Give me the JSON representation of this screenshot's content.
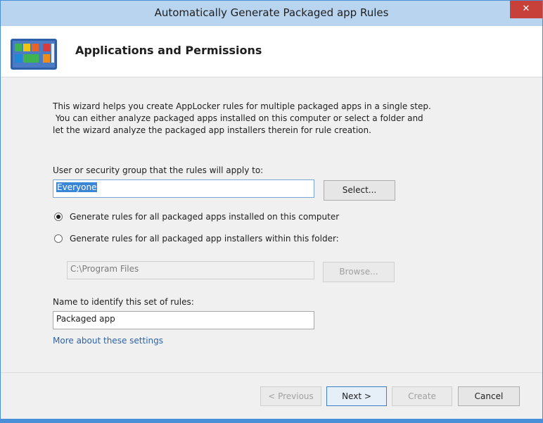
{
  "window": {
    "title": "Automatically Generate Packaged app Rules",
    "close_glyph": "✕"
  },
  "header": {
    "heading": "Applications and Permissions",
    "icon": "applocker-packaged-apps-icon"
  },
  "description": {
    "line1": "This wizard helps you create AppLocker rules for multiple packaged apps in a single step.",
    "line2": " You can either analyze packaged apps installed on this computer or select a folder and",
    "line3": "let the wizard analyze the packaged app installers therein for rule creation."
  },
  "user_group": {
    "label": "User or security group that the rules will apply to:",
    "value": "Everyone",
    "select_button": "Select..."
  },
  "options": {
    "installed_label": "Generate rules for all packaged apps installed on this computer",
    "installed_checked": true,
    "folder_label": "Generate rules for all packaged app installers within this folder:",
    "folder_checked": false,
    "folder_path": "C:\\Program Files",
    "browse_button": "Browse..."
  },
  "rule_name": {
    "label": "Name to identify this set of rules:",
    "value": "Packaged app"
  },
  "more_link": "More about these settings",
  "footer": {
    "previous": "< Previous",
    "next": "Next >",
    "create": "Create",
    "cancel": "Cancel"
  },
  "colors": {
    "accent": "#4a90d9",
    "titlebar": "#b8d4ef",
    "close": "#c7403a",
    "link": "#2e62a8"
  }
}
